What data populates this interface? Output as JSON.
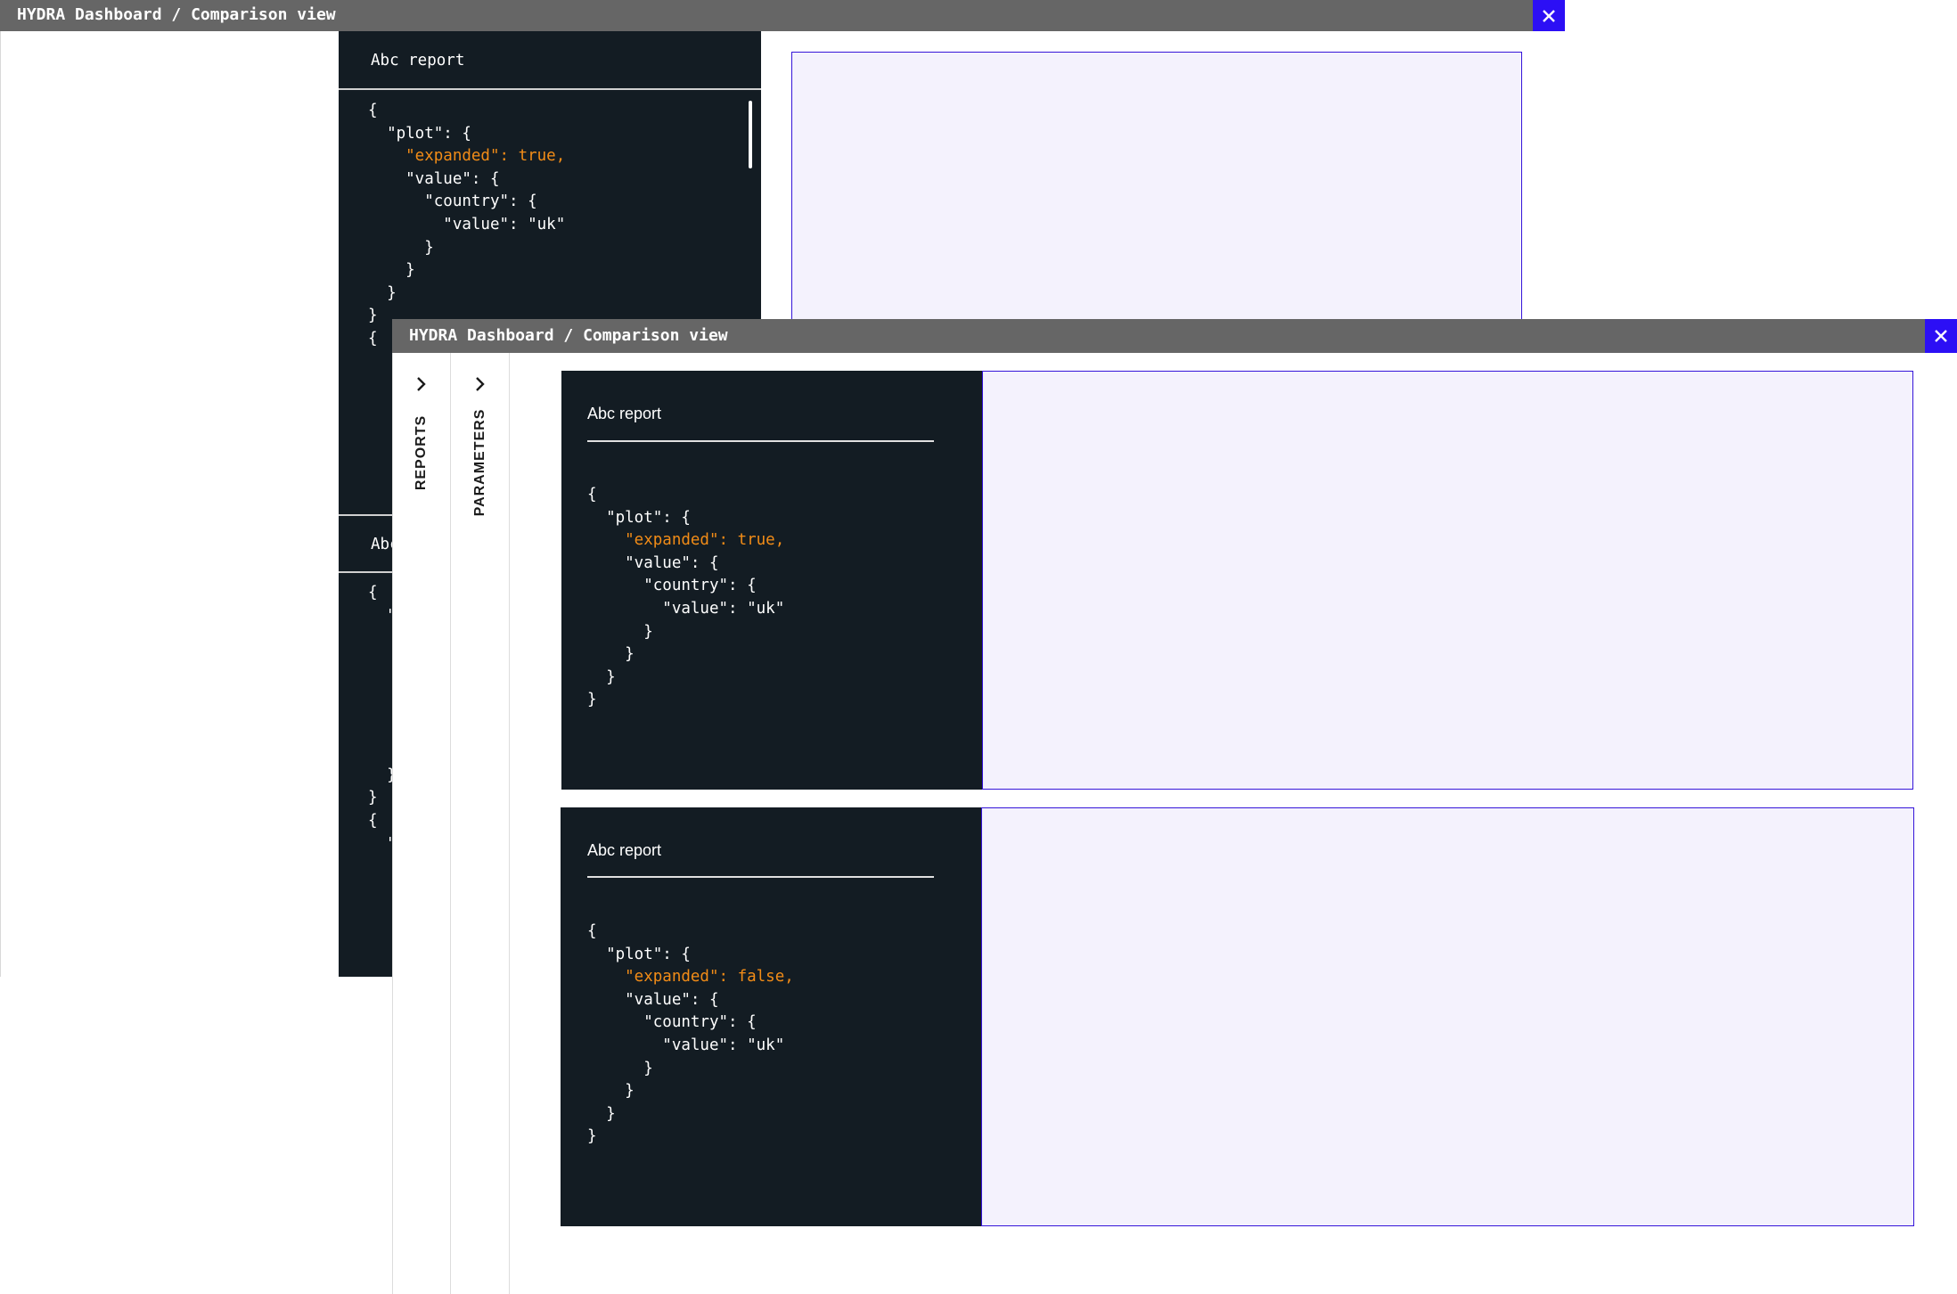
{
  "back_window": {
    "title": "HYDRA Dashboard / Comparison view",
    "report1": {
      "title": "Abc report",
      "code_lines": [
        "{",
        "  \"plot\": {",
        "    \"expanded\": true,",
        "    \"value\": {",
        "      \"country\": {",
        "        \"value\": \"uk\"",
        "      }",
        "    }",
        "  }",
        "}",
        "{"
      ]
    },
    "report2": {
      "title": "Abc",
      "code_lines": [
        "{",
        "  \"",
        "",
        "",
        "",
        "",
        "",
        "",
        "  }",
        "}",
        "{",
        "  \""
      ]
    }
  },
  "front_window": {
    "title": "HYDRA Dashboard / Comparison view",
    "rail": [
      {
        "label": "REPORTS",
        "icon": "chevron-right-icon"
      },
      {
        "label": "PARAMETERS",
        "icon": "chevron-right-icon"
      }
    ],
    "cards": [
      {
        "title": "Abc report",
        "code_lines": [
          "{",
          "  \"plot\": {",
          "    \"expanded\": true,",
          "    \"value\": {",
          "      \"country\": {",
          "        \"value\": \"uk\"",
          "      }",
          "    }",
          "  }",
          "}"
        ]
      },
      {
        "title": "Abc report",
        "code_lines": [
          "{",
          "  \"plot\": {",
          "    \"expanded\": false,",
          "    \"value\": {",
          "      \"country\": {",
          "        \"value\": \"uk\"",
          "      }",
          "    }",
          "  }",
          "}"
        ]
      }
    ]
  },
  "colors": {
    "titlebar": "#666666",
    "close_button": "#2c0ff5",
    "code_panel": "#131c23",
    "highlight": "#f28c17",
    "plot_fill": "#f4f2fd",
    "plot_border": "#3515d9"
  },
  "icons": {
    "close": "close-icon",
    "chevron": "chevron-right-icon"
  }
}
